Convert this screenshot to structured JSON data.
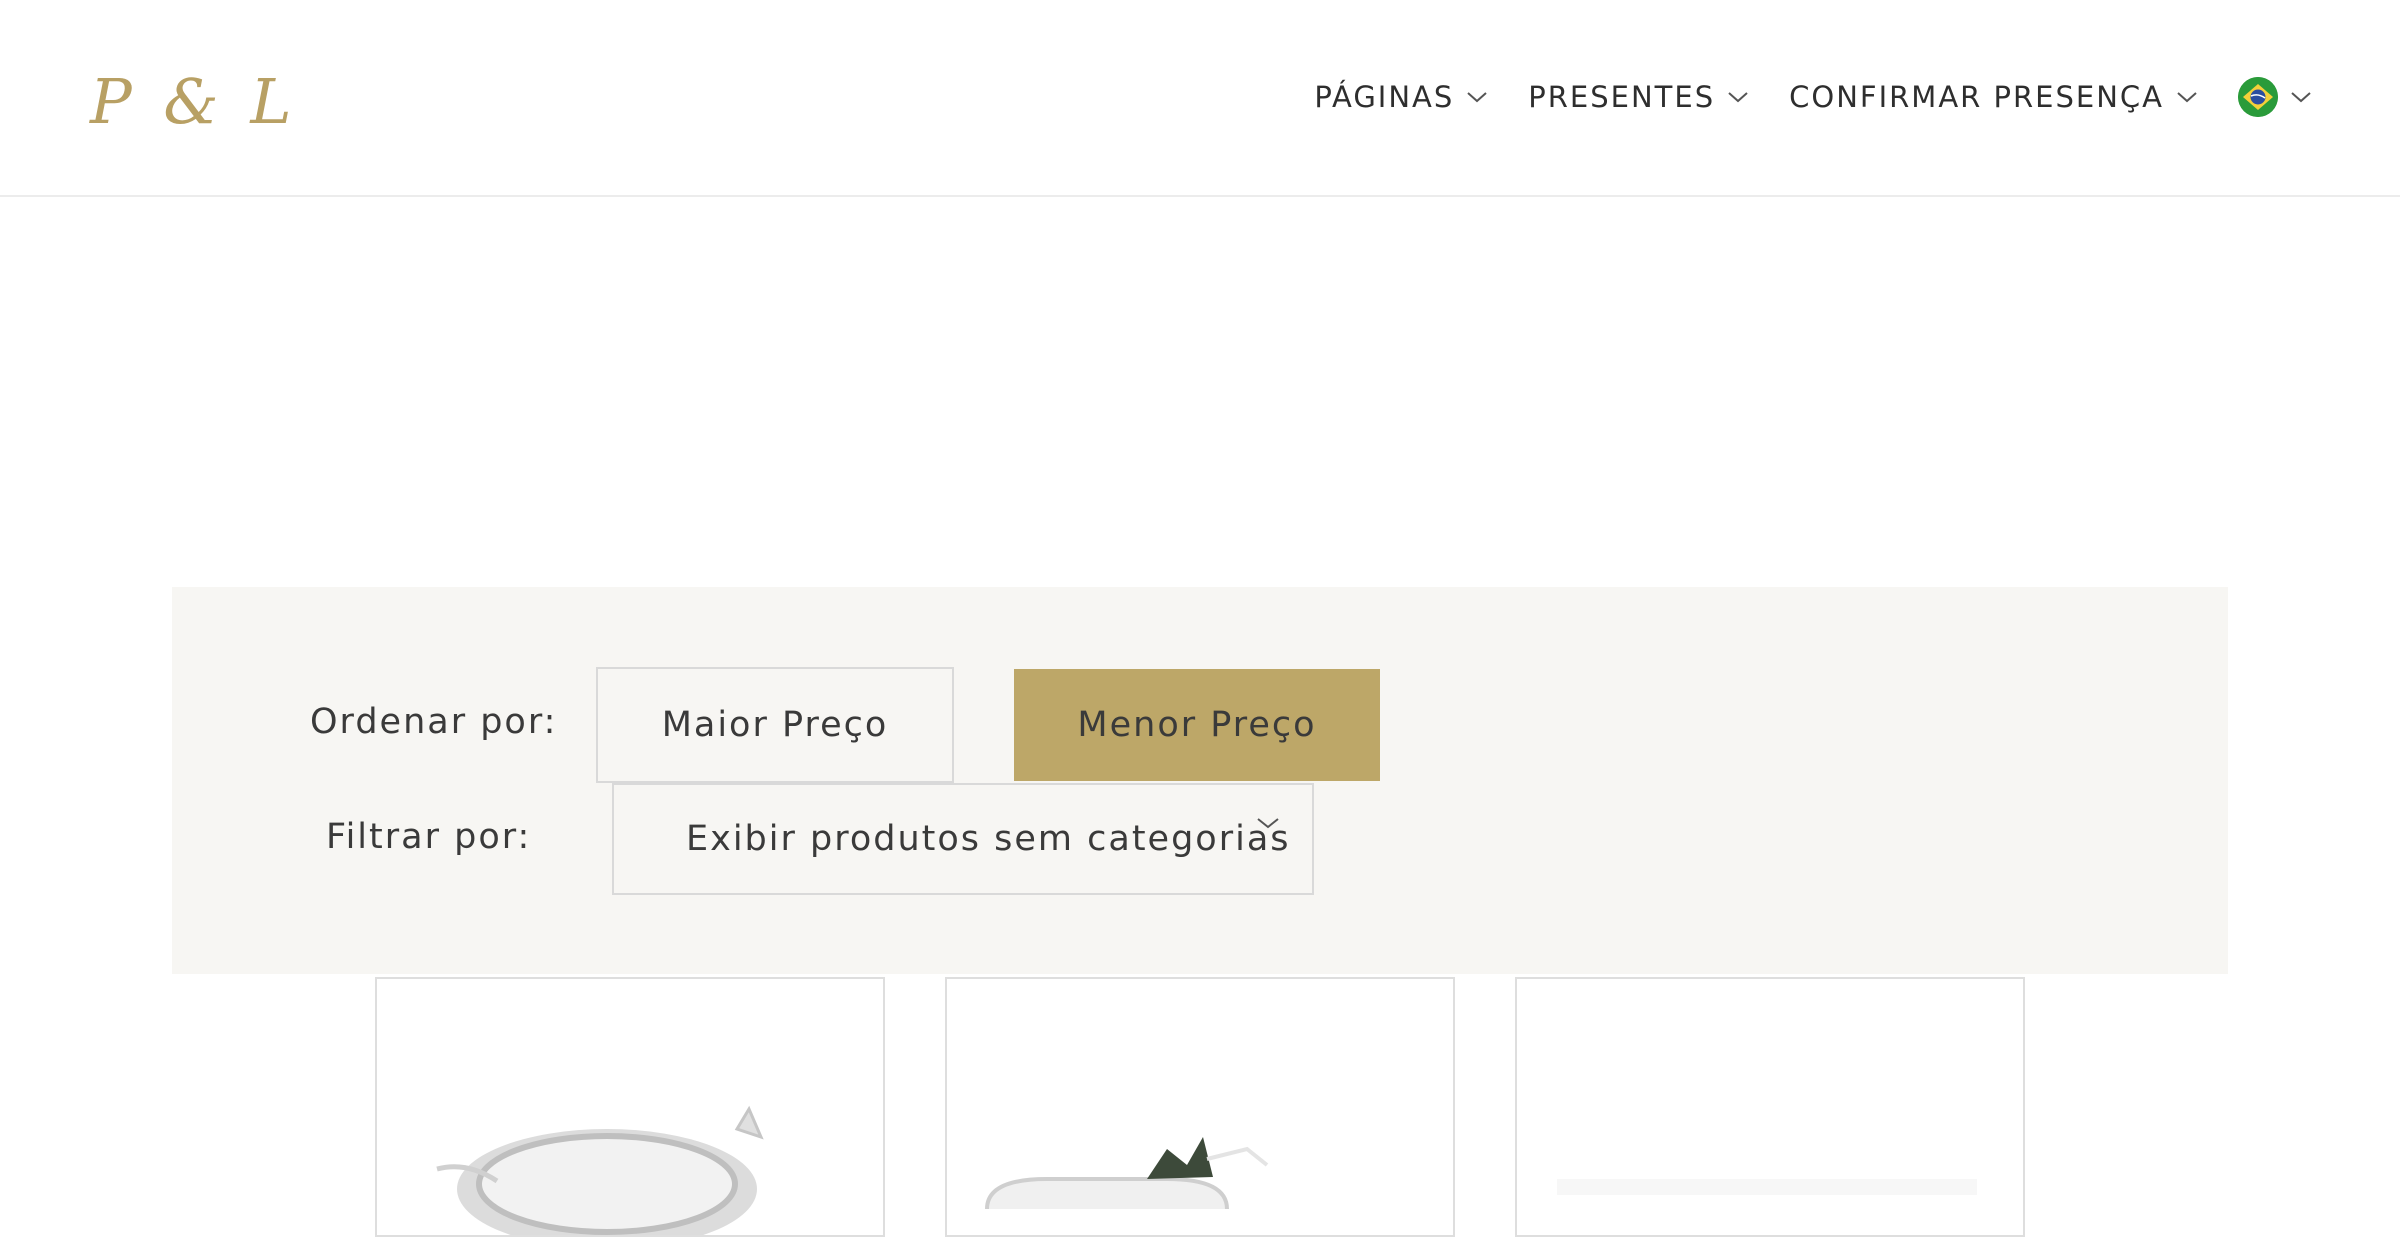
{
  "header": {
    "logo": "P & L",
    "nav": [
      {
        "label": "PÁGINAS"
      },
      {
        "label": "PRESENTES"
      },
      {
        "label": "CONFIRMAR PRESENÇA"
      }
    ],
    "language_flag": "brazil-flag-icon"
  },
  "filters": {
    "sort_label": "Ordenar por:",
    "sort_options": [
      {
        "label": "Maior Preço",
        "active": false
      },
      {
        "label": "Menor Preço",
        "active": true
      }
    ],
    "filter_label": "Filtrar por:",
    "filter_selected": "Exibir produtos sem categorias"
  },
  "colors": {
    "accent": "#bda768",
    "logo": "#b8a064",
    "panel_bg": "#f7f6f3"
  }
}
